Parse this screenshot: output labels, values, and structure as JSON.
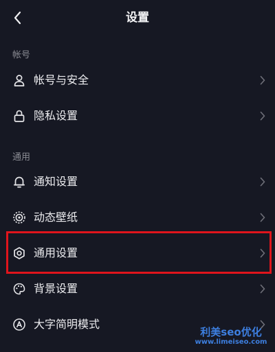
{
  "header": {
    "title": "设置",
    "back_icon": "back-arrow-icon"
  },
  "sections": [
    {
      "label": "帐号",
      "items": [
        {
          "label": "帐号与安全",
          "icon": "user-icon"
        },
        {
          "label": "隐私设置",
          "icon": "lock-icon"
        }
      ]
    },
    {
      "label": "通用",
      "items": [
        {
          "label": "通知设置",
          "icon": "bell-icon"
        },
        {
          "label": "动态壁纸",
          "icon": "dynamic-wallpaper-icon"
        },
        {
          "label": "通用设置",
          "icon": "gear-icon",
          "highlighted": true
        },
        {
          "label": "背景设置",
          "icon": "palette-icon"
        },
        {
          "label": "大字简明模式",
          "icon": "large-font-icon"
        }
      ]
    }
  ],
  "highlight_color": "#e0141c",
  "watermark": {
    "main": "利美seo优化",
    "url": "www.limeiseo.com"
  }
}
